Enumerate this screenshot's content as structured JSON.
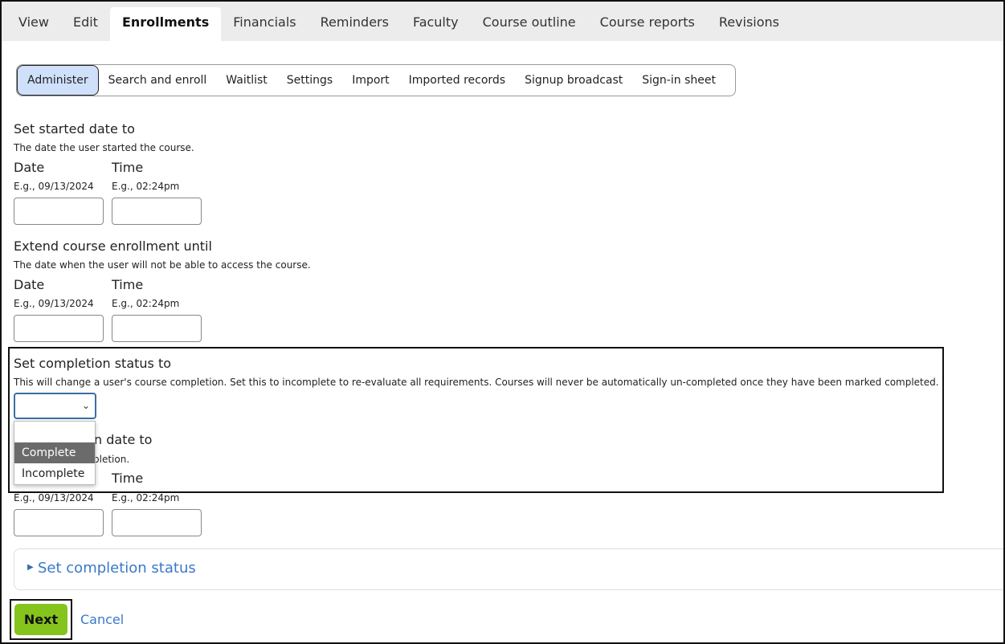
{
  "top_tabs": [
    "View",
    "Edit",
    "Enrollments",
    "Financials",
    "Reminders",
    "Faculty",
    "Course outline",
    "Course reports",
    "Revisions"
  ],
  "active_top_tab": "Enrollments",
  "sub_tabs": [
    "Administer",
    "Search and enroll",
    "Waitlist",
    "Settings",
    "Import",
    "Imported records",
    "Signup broadcast",
    "Sign-in sheet"
  ],
  "active_sub_tab": "Administer",
  "started": {
    "title": "Set started date to",
    "desc": "The date the user started the course.",
    "date_label": "Date",
    "date_hint": "E.g., 09/13/2024",
    "time_label": "Time",
    "time_hint": "E.g., 02:24pm"
  },
  "extend": {
    "title": "Extend course enrollment until",
    "desc": "The date when the user will not be able to access the course.",
    "date_label": "Date",
    "date_hint": "E.g., 09/13/2024",
    "time_label": "Time",
    "time_hint": "E.g., 02:24pm"
  },
  "completion_status": {
    "title": "Set completion status to",
    "desc": "This will change a user's course completion. Set this to incomplete to re-evaluate all requirements. Courses will never be automatically un-completed once they have been marked completed.",
    "selected_value": "",
    "options": [
      "",
      "Complete",
      "Incomplete"
    ],
    "highlighted_option": "Complete"
  },
  "completion_date": {
    "title_visible_fragment": "n date to",
    "desc_visible_fragment": "pletion.",
    "time_label": "Time",
    "date_hint": "E.g., 09/13/2024",
    "time_hint": "E.g., 02:24pm"
  },
  "collapsible": {
    "title": "Set completion status"
  },
  "actions": {
    "next_label": "Next",
    "cancel_label": "Cancel",
    "next_color": "#84c41c"
  }
}
